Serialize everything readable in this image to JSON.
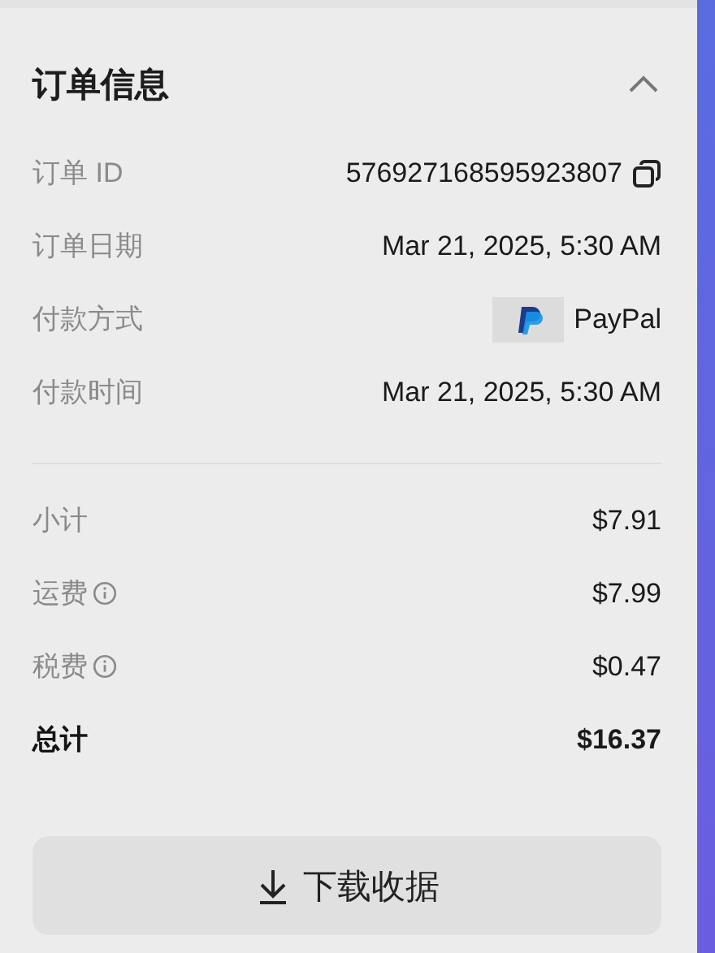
{
  "section": {
    "title": "订单信息",
    "expanded": true
  },
  "details": [
    {
      "kind": "copy",
      "label": "订单 ID",
      "value": "576927168595923807"
    },
    {
      "kind": "text",
      "label": "订单日期",
      "value": "Mar 21, 2025, 5:30 AM"
    },
    {
      "kind": "payment",
      "label": "付款方式",
      "value": "PayPal"
    },
    {
      "kind": "text",
      "label": "付款时间",
      "value": "Mar 21, 2025, 5:30 AM"
    }
  ],
  "summary": [
    {
      "label": "小计",
      "value": "$7.91",
      "info": false,
      "total": false
    },
    {
      "label": "运费",
      "value": "$7.99",
      "info": true,
      "total": false
    },
    {
      "label": "税费",
      "value": "$0.47",
      "info": true,
      "total": false
    },
    {
      "label": "总计",
      "value": "$16.37",
      "info": false,
      "total": true
    }
  ],
  "download_button": {
    "label": "下载收据"
  }
}
